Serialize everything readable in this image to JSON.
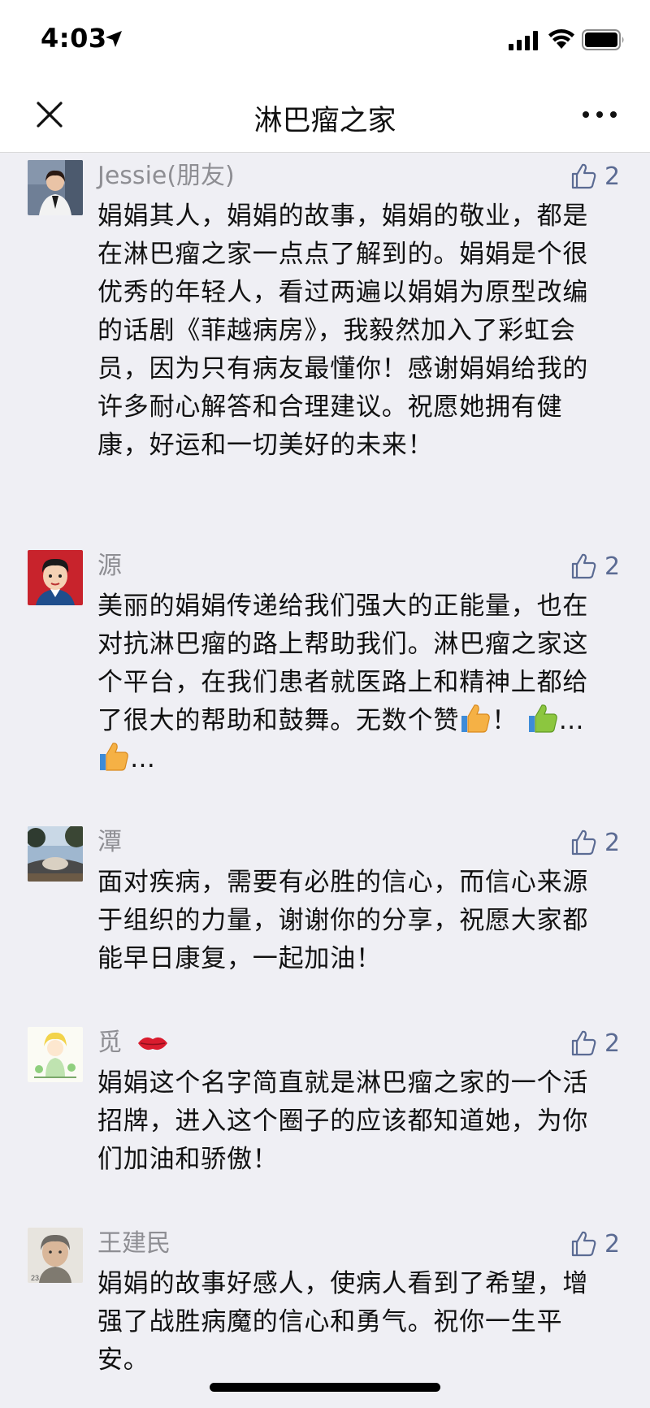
{
  "status_bar": {
    "time": "4:03"
  },
  "nav": {
    "title": "淋巴瘤之家"
  },
  "comments": [
    {
      "name": "Jessie(朋友)",
      "likes": "2",
      "text": "娟娟其人，娟娟的故事，娟娟的敬业，都是在淋巴瘤之家一点点了解到的。娟娟是个很优秀的年轻人，看过两遍以娟娟为原型改编的话剧《菲越病房》，我毅然加入了彩虹会员，因为只有病友最懂你！感谢娟娟给我的许多耐心解答和合理建议。祝愿她拥有健康，好运和一切美好的未来！"
    },
    {
      "name": "源",
      "likes": "2",
      "text": "美丽的娟娟传递给我们强大的正能量，也在对抗淋巴瘤的路上帮助我们。淋巴瘤之家这个平台，在我们患者就医路上和精神上都给了很大的帮助和鼓舞。无数个赞",
      "text_mid": "！ ",
      "text_dots1": "…",
      "text_dots2": "…"
    },
    {
      "name": "潭",
      "likes": "2",
      "text": "面对疾病，需要有必胜的信心，而信心来源于组织的力量，谢谢你的分享，祝愿大家都能早日康复，一起加油！"
    },
    {
      "name": "觅",
      "likes": "2",
      "text": "娟娟这个名字简直就是淋巴瘤之家的一个活招牌，进入这个圈子的应该都知道她，为你们加油和骄傲！"
    },
    {
      "name": "王建民",
      "likes": "2",
      "avatar_badge": "23",
      "text": "娟娟的故事好感人，使病人看到了希望，增强了战胜病魔的信心和勇气。祝你一生平安。"
    }
  ],
  "colors": {
    "like_blue": "#5b6b93",
    "name_gray": "#8e8e93",
    "background": "#efeff4"
  }
}
